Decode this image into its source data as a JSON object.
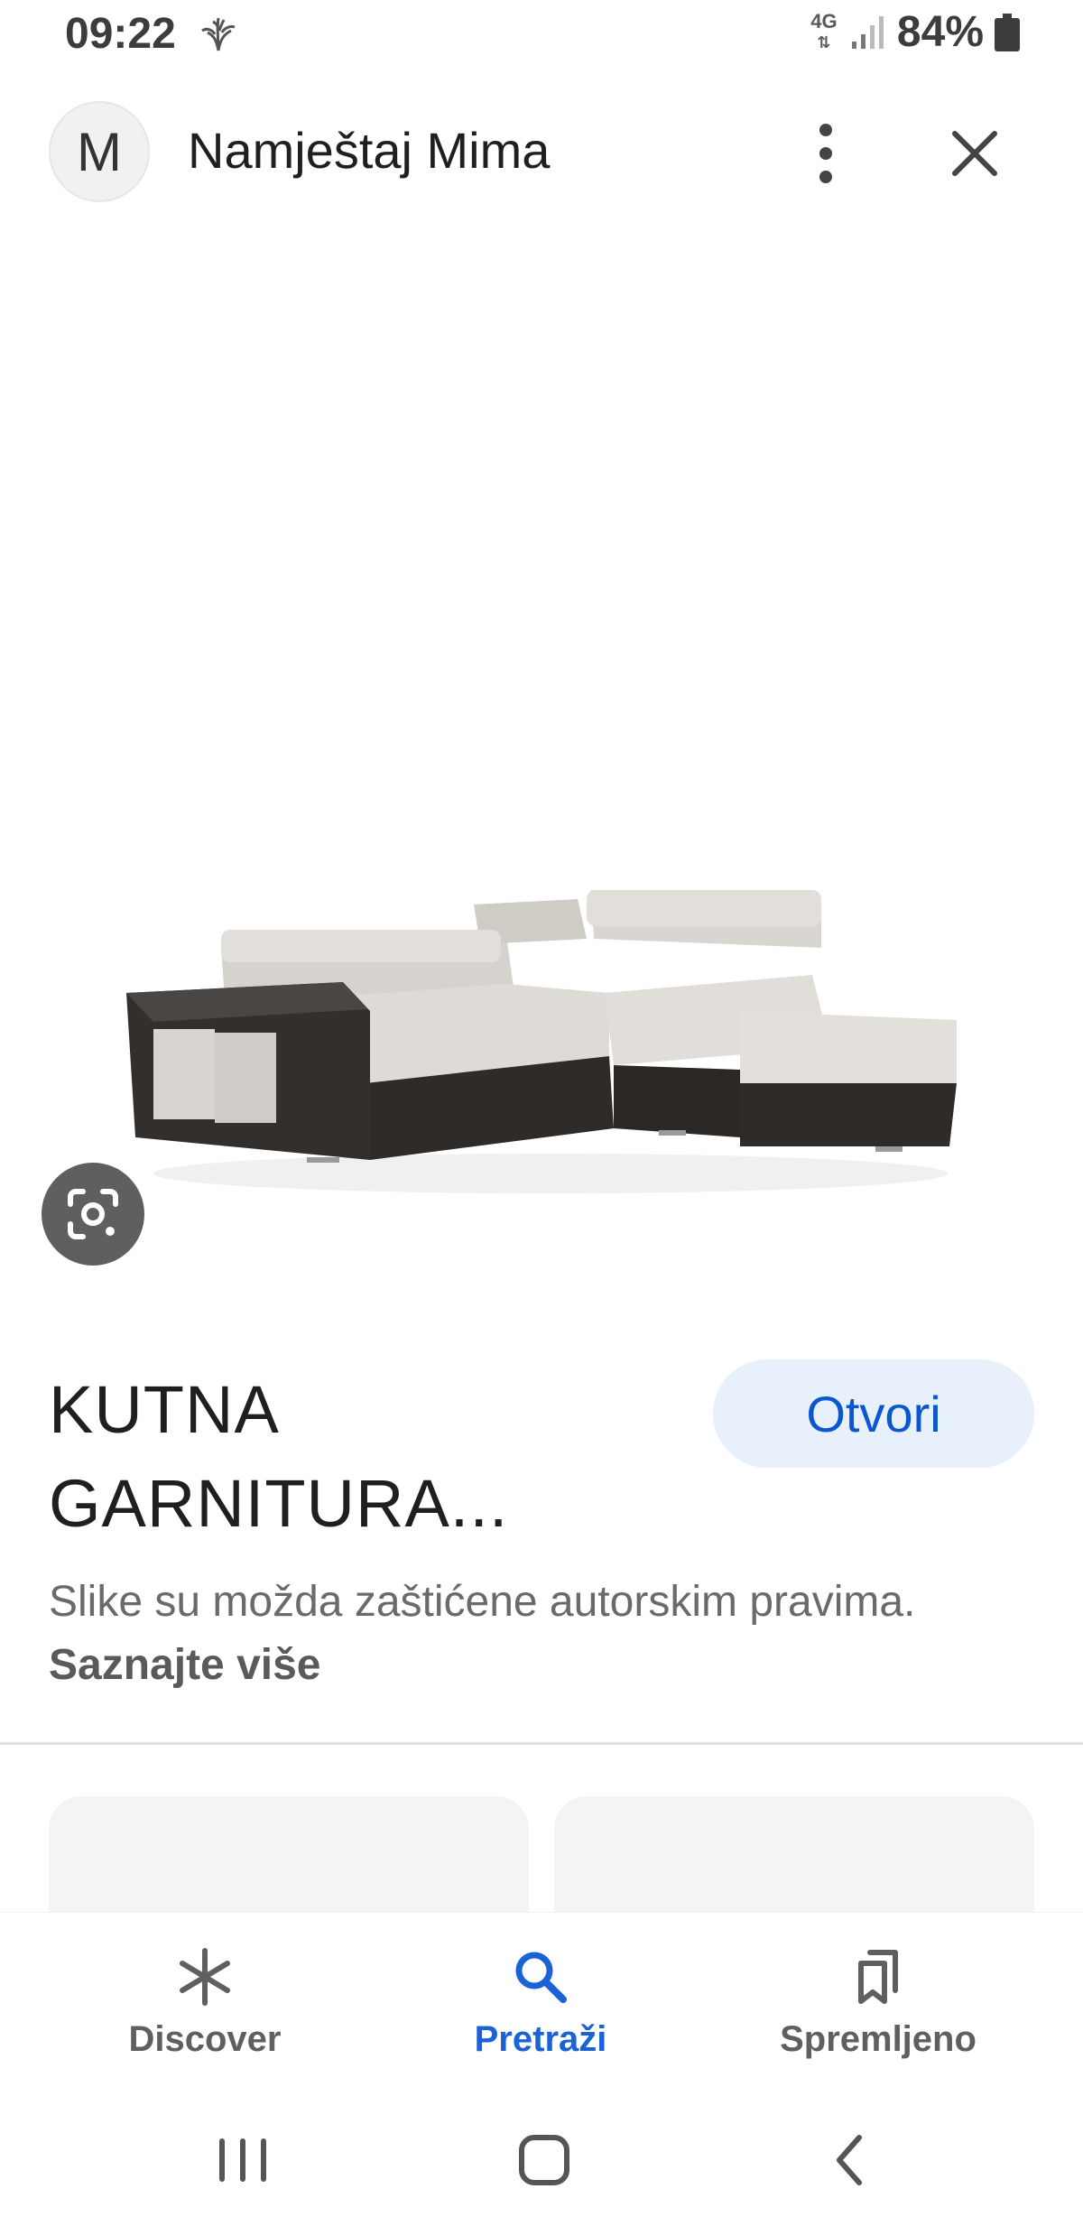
{
  "status_bar": {
    "time": "09:22",
    "network": "4G",
    "battery_percent": "84%",
    "flower_icon": "flower-notification-icon",
    "signal_icon": "signal-icon",
    "battery_icon": "battery-icon"
  },
  "header": {
    "avatar_letter": "M",
    "site_name": "Namještaj Mima",
    "more_icon": "more-vert-icon",
    "close_icon": "close-icon"
  },
  "image": {
    "lens_icon": "google-lens-icon"
  },
  "result": {
    "title_line1": "KUTNA",
    "title_line2": "GARNITURA...",
    "open_button": "Otvori",
    "copyright_text": "Slike su možda zaštićene autorskim pravima.",
    "learn_more": "Saznajte više"
  },
  "bottom_nav": {
    "items": [
      {
        "label": "Discover",
        "icon": "asterisk-icon",
        "active": false
      },
      {
        "label": "Pretraži",
        "icon": "search-icon",
        "active": true
      },
      {
        "label": "Spremljeno",
        "icon": "bookmarks-icon",
        "active": false
      }
    ]
  },
  "system_nav": {
    "recent": "recent-apps-icon",
    "home": "home-icon",
    "back": "back-icon"
  },
  "colors": {
    "accent": "#0b57d0",
    "accent_light": "#e8f0fc",
    "nav_active": "#1a62d6",
    "text_secondary": "#6a6a6a"
  }
}
